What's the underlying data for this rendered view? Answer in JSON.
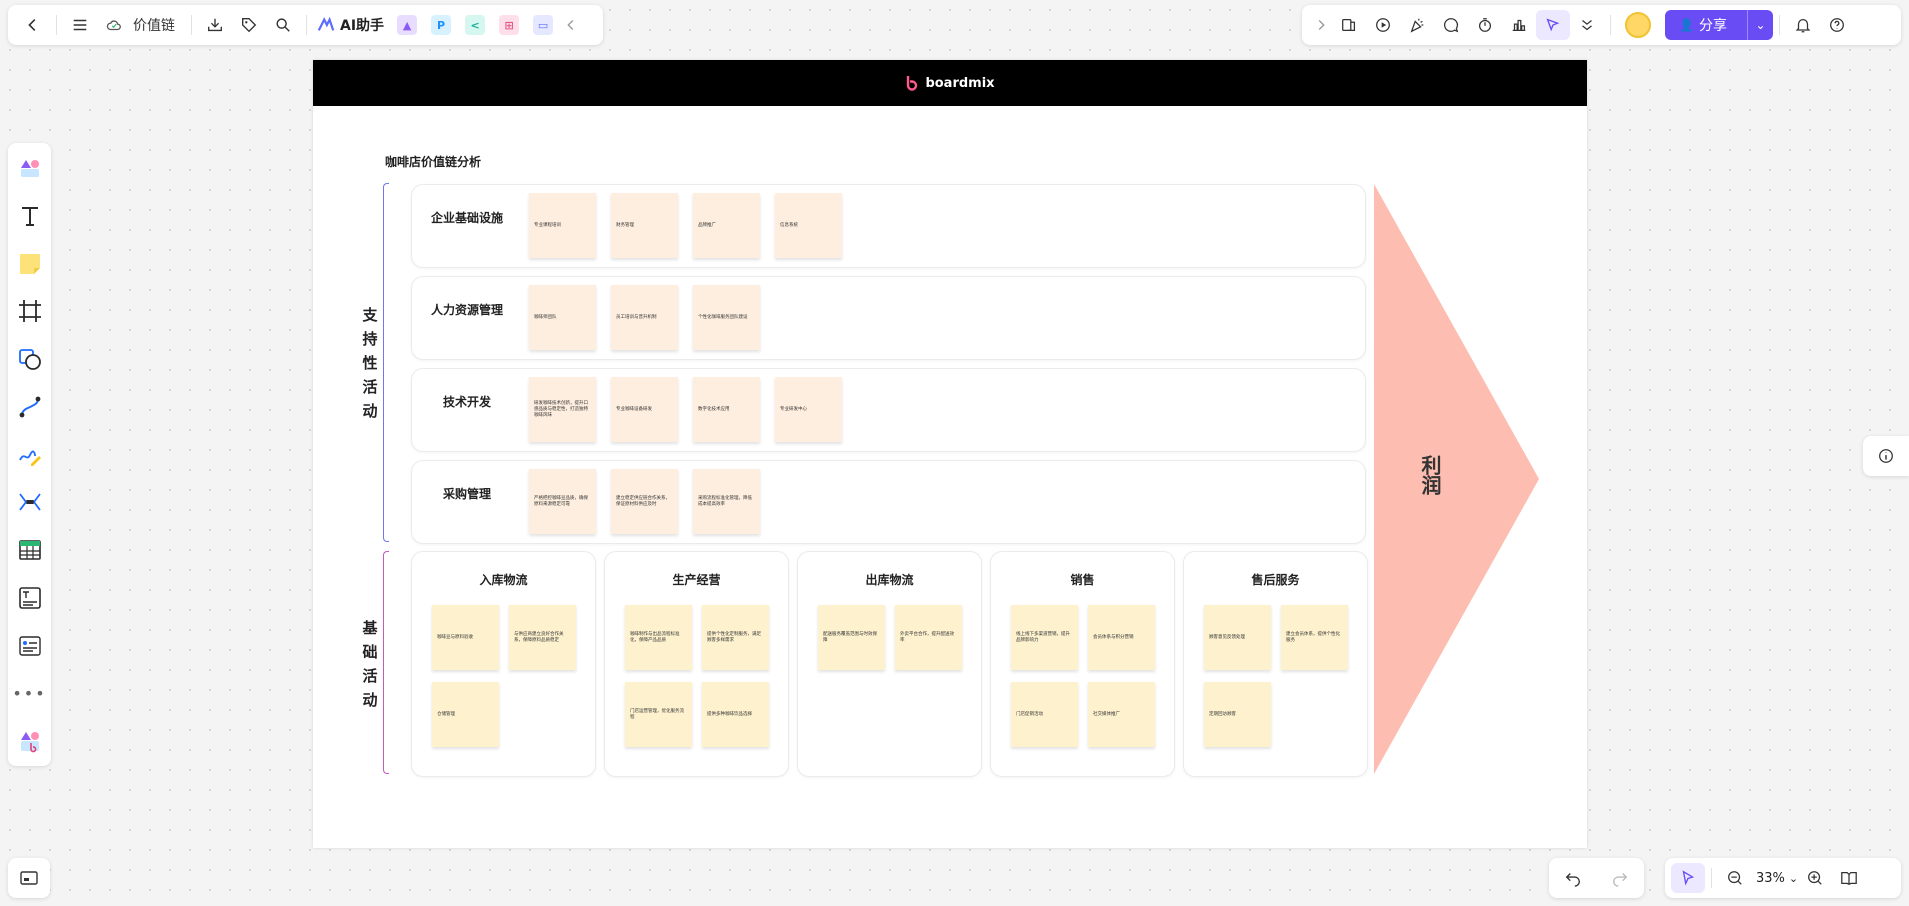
{
  "app": {
    "doc_title": "价值链",
    "ai_label": "AI助手",
    "share_label": "分享",
    "zoom": "33%"
  },
  "colors": {
    "accent": "#6a4cf5",
    "support_brace": "#6e78f0",
    "primary_brace": "#c25ac0",
    "profit": "#fdbdb0"
  },
  "canvas": {
    "brand": "boardmix",
    "title": "咖啡店价值链分析",
    "profit": "利润",
    "support_label": "支持性活动",
    "primary_label": "基础活动"
  },
  "support": [
    {
      "label": "企业基础设施",
      "notes": [
        "专业课程培训",
        "财务管理",
        "品牌推广",
        "信息系统"
      ]
    },
    {
      "label": "人力资源管理",
      "notes": [
        "咖啡师团队",
        "员工培训与晋升机制",
        "个性化咖啡服务团队建设"
      ]
    },
    {
      "label": "技术开发",
      "notes": [
        "研发咖啡技术创新，提升口感品质与稳定性，打造独特咖啡风味",
        "专业咖啡设备研发",
        "数字化技术应用",
        "专业研发中心"
      ]
    },
    {
      "label": "采购管理",
      "notes": [
        "严格把控咖啡豆品质，确保原料来源稳定可靠",
        "建立稳定供应链合作关系，保证原材料供应及时",
        "采购流程标准化管理，降低成本提高效率"
      ]
    }
  ],
  "primary": [
    {
      "label": "入库物流",
      "notes": [
        "咖啡豆与原料验收",
        "与供应商建立良好合作关系，保障原料品质稳定",
        "仓储管理"
      ]
    },
    {
      "label": "生产经营",
      "notes": [
        "咖啡制作与出品流程标准化，保障产品品质",
        "提供个性化定制服务，满足顾客多样需求",
        "门店运营管理，优化服务流程",
        "提供多种咖啡饮品选择"
      ]
    },
    {
      "label": "出库物流",
      "notes": [
        "配送服务覆盖范围与时效保障",
        "外卖平台合作，提升配送效率"
      ]
    },
    {
      "label": "销售",
      "notes": [
        "线上线下多渠道营销，提升品牌影响力",
        "会员体系与积分营销",
        "门店促销活动",
        "社交媒体推广"
      ]
    },
    {
      "label": "售后服务",
      "notes": [
        "顾客意见反馈处理",
        "建立会员体系，提供个性化服务",
        "定期回访顾客"
      ]
    }
  ]
}
